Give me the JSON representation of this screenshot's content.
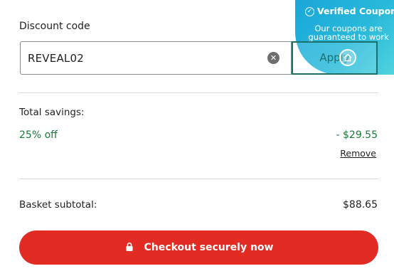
{
  "discount": {
    "label": "Discount code",
    "code_value": "REVEAL02",
    "apply_label": "Apply"
  },
  "coupon_badge": {
    "title": "Verified Coupon",
    "subtitle": "Our coupons are guaranteed to work",
    "check_icon": "check-circle-icon",
    "color_start": "#1aa6d9",
    "color_end": "#4fd3df"
  },
  "savings": {
    "label": "Total savings:",
    "percent": "25% off",
    "amount": "- $29.55",
    "remove_label": "Remove",
    "color": "#1a7a3b"
  },
  "subtotal": {
    "label": "Basket subtotal:",
    "amount": "$88.65"
  },
  "checkout": {
    "label": "Checkout securely now",
    "icon": "lock-icon",
    "color": "#e22b22"
  }
}
